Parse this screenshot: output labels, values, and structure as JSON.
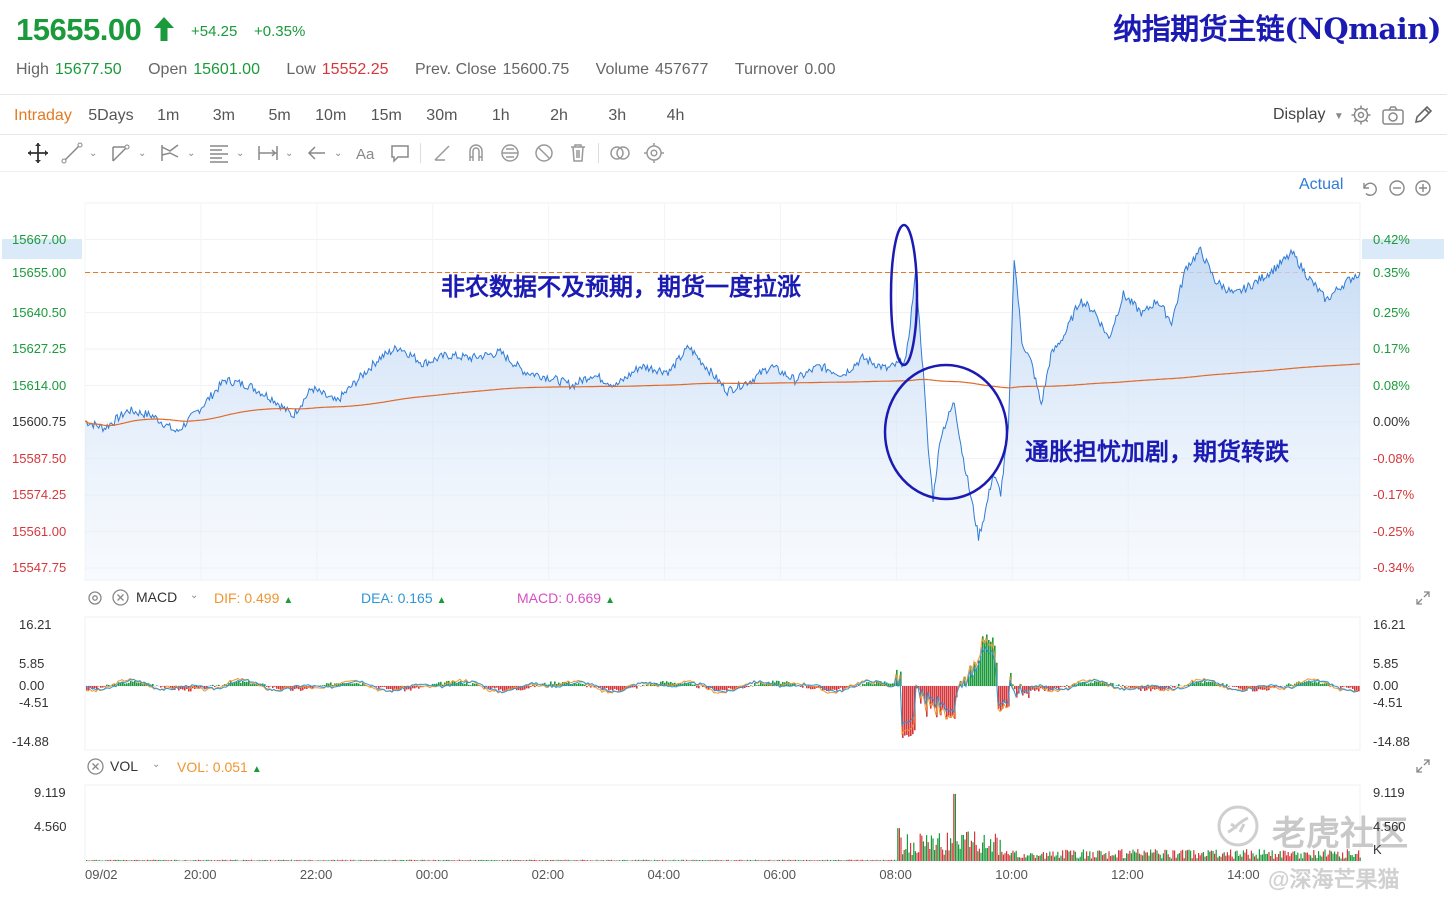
{
  "app_title": "纳指期货主链(NQmain)",
  "quote": {
    "price": "15655.00",
    "change": "+54.25",
    "change_pct": "+0.35%"
  },
  "stats": [
    {
      "label": "High",
      "value": "15677.50",
      "color": "green"
    },
    {
      "label": "Open",
      "value": "15601.00",
      "color": "green"
    },
    {
      "label": "Low",
      "value": "15552.25",
      "color": "red"
    },
    {
      "label": "Prev. Close",
      "value": "15600.75",
      "color": "gray"
    },
    {
      "label": "Volume",
      "value": "457677",
      "color": "gray"
    },
    {
      "label": "Turnover",
      "value": "0.00",
      "color": "gray"
    }
  ],
  "periods": [
    "Intraday",
    "5Days",
    "1m",
    "3m",
    "5m",
    "10m",
    "15m",
    "30m",
    "1h",
    "2h",
    "3h",
    "4h"
  ],
  "active_period": "Intraday",
  "display_label": "Display",
  "price_mode": "Actual",
  "price_axis_left": [
    {
      "label": "15667.00",
      "color": "green"
    },
    {
      "label": "15655.00",
      "color": "green"
    },
    {
      "label": "15640.50",
      "color": "green"
    },
    {
      "label": "15627.25",
      "color": "green"
    },
    {
      "label": "15614.00",
      "color": "green"
    },
    {
      "label": "15600.75",
      "color": "gray"
    },
    {
      "label": "15587.50",
      "color": "red"
    },
    {
      "label": "15574.25",
      "color": "red"
    },
    {
      "label": "15561.00",
      "color": "red"
    },
    {
      "label": "15547.75",
      "color": "red"
    }
  ],
  "price_axis_right": [
    {
      "label": "0.42%",
      "color": "green"
    },
    {
      "label": "0.35%",
      "color": "green"
    },
    {
      "label": "0.25%",
      "color": "green"
    },
    {
      "label": "0.17%",
      "color": "green"
    },
    {
      "label": "0.08%",
      "color": "green"
    },
    {
      "label": "0.00%",
      "color": "gray"
    },
    {
      "label": "-0.08%",
      "color": "red"
    },
    {
      "label": "-0.17%",
      "color": "red"
    },
    {
      "label": "-0.25%",
      "color": "red"
    },
    {
      "label": "-0.34%",
      "color": "red"
    }
  ],
  "annotations": {
    "rise": "非农数据不及预期，期货一度拉涨",
    "fall": "通胀担忧加剧，期货转跌"
  },
  "macd": {
    "name": "MACD",
    "dif_label": "DIF:",
    "dif_value": "0.499",
    "dea_label": "DEA:",
    "dea_value": "0.165",
    "macd_label": "MACD:",
    "macd_value": "0.669",
    "axis": [
      "16.21",
      "5.85",
      "0.00",
      "-4.51",
      "-14.88"
    ]
  },
  "vol": {
    "name": "VOL",
    "vol_label": "VOL:",
    "vol_value": "0.051",
    "axis_left": [
      "9.119",
      "4.560"
    ],
    "axis_right": [
      "9.119",
      "4.560",
      "K"
    ]
  },
  "time_labels": [
    "09/02",
    "20:00",
    "22:00",
    "00:00",
    "02:00",
    "04:00",
    "06:00",
    "08:00",
    "10:00",
    "12:00",
    "14:00"
  ],
  "watermark": {
    "brand": "老虎社区",
    "handle": "@深海芒果猫"
  },
  "colors": {
    "up": "#1a9a3a",
    "down": "#d6373c",
    "accent": "#e67a22",
    "line": "#2f7bd6",
    "avg": "#e06a2a",
    "annot": "#1b1bb3"
  },
  "chart_data": {
    "type": "line",
    "x_range": [
      "18:00",
      "16:00"
    ],
    "ylim": [
      15547.75,
      15680.25
    ],
    "reference": 15600.75,
    "last": 15655.0,
    "series": [],
    "points": [
      [
        "18:00",
        15601.0
      ],
      [
        "18:20",
        15598.5
      ],
      [
        "18:45",
        15605.0
      ],
      [
        "19:10",
        15603.0
      ],
      [
        "19:35",
        15597.0
      ],
      [
        "20:00",
        15606.0
      ],
      [
        "20:25",
        15616.0
      ],
      [
        "20:50",
        15614.0
      ],
      [
        "21:15",
        15609.0
      ],
      [
        "21:35",
        15603.0
      ],
      [
        "21:55",
        15613.0
      ],
      [
        "22:20",
        15608.0
      ],
      [
        "22:45",
        15617.0
      ],
      [
        "23:05",
        15624.0
      ],
      [
        "23:25",
        15628.0
      ],
      [
        "23:50",
        15622.0
      ],
      [
        "00:15",
        15625.0
      ],
      [
        "00:40",
        15624.0
      ],
      [
        "01:10",
        15626.0
      ],
      [
        "01:35",
        15619.0
      ],
      [
        "02:00",
        15617.0
      ],
      [
        "02:25",
        15614.0
      ],
      [
        "02:45",
        15618.0
      ],
      [
        "03:10",
        15614.0
      ],
      [
        "03:35",
        15621.0
      ],
      [
        "04:05",
        15619.0
      ],
      [
        "04:25",
        15628.0
      ],
      [
        "04:45",
        15620.0
      ],
      [
        "05:05",
        15612.0
      ],
      [
        "05:30",
        15616.0
      ],
      [
        "05:50",
        15621.0
      ],
      [
        "06:15",
        15616.0
      ],
      [
        "06:40",
        15621.0
      ],
      [
        "07:05",
        15618.0
      ],
      [
        "07:25",
        15624.0
      ],
      [
        "07:50",
        15620.0
      ],
      [
        "08:10",
        15623.0
      ],
      [
        "08:20",
        15655.0
      ],
      [
        "08:28",
        15618.0
      ],
      [
        "08:33",
        15591.0
      ],
      [
        "08:38",
        15573.0
      ],
      [
        "08:46",
        15596.0
      ],
      [
        "09:00",
        15608.0
      ],
      [
        "09:08",
        15590.0
      ],
      [
        "09:18",
        15572.0
      ],
      [
        "09:25",
        15559.0
      ],
      [
        "09:32",
        15568.0
      ],
      [
        "09:40",
        15582.0
      ],
      [
        "09:48",
        15575.0
      ],
      [
        "09:56",
        15598.0
      ],
      [
        "10:02",
        15661.0
      ],
      [
        "10:10",
        15630.0
      ],
      [
        "10:20",
        15622.0
      ],
      [
        "10:30",
        15607.0
      ],
      [
        "10:40",
        15625.0
      ],
      [
        "10:55",
        15633.0
      ],
      [
        "11:10",
        15645.0
      ],
      [
        "11:25",
        15641.0
      ],
      [
        "11:40",
        15631.0
      ],
      [
        "11:55",
        15647.0
      ],
      [
        "12:15",
        15640.0
      ],
      [
        "12:30",
        15645.0
      ],
      [
        "12:45",
        15637.0
      ],
      [
        "13:00",
        15657.0
      ],
      [
        "13:15",
        15663.0
      ],
      [
        "13:30",
        15652.0
      ],
      [
        "13:50",
        15647.0
      ],
      [
        "14:10",
        15651.0
      ],
      [
        "14:30",
        15656.0
      ],
      [
        "14:50",
        15662.0
      ],
      [
        "15:05",
        15654.0
      ],
      [
        "15:25",
        15645.0
      ],
      [
        "15:40",
        15650.0
      ],
      [
        "15:55",
        15654.0
      ],
      [
        "16:00",
        15655.0
      ]
    ]
  }
}
